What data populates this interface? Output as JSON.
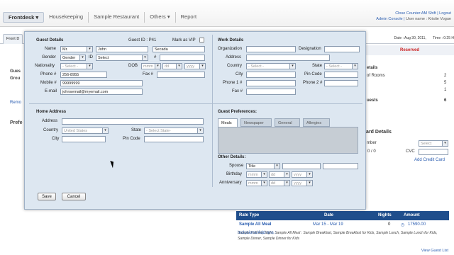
{
  "nav": {
    "items": [
      {
        "label": "Frontdesk ▾"
      },
      {
        "label": "Housekeeping"
      },
      {
        "label": "Sample Restaurant"
      },
      {
        "label": "Others ▾"
      },
      {
        "label": "Report"
      }
    ]
  },
  "header": {
    "close_counter": "Close Counter:AM Shift",
    "logout": "Logout",
    "admin_console": "Admin Console",
    "user_name": "User name : Kristie Vogue"
  },
  "background": {
    "front_tab": "Front D",
    "date": "Date : Aug 30, 2011,",
    "time": "Time : 0:25 H",
    "status": "Reserved",
    "guest_initial": "Gues",
    "group_initial": "Grou",
    "remove": "Remo",
    "prefs": "Prefe",
    "details": "etails",
    "rooms_label": "of Rooms",
    "rooms_val1": "2",
    "rooms_val2": "5",
    "rooms_val3": "1",
    "guests_label": "uests",
    "guests_val": "6",
    "card_details": "Card Details",
    "number_label": "mber",
    "number_val": "0  / 0",
    "cvc": "CVC",
    "select": "Select",
    "add_credit_card": "Add Credit Card",
    "view_guest_list": "View Guest List"
  },
  "rate_table": {
    "headers": {
      "rate_type": "Rate Type",
      "date": "Date",
      "nights": "Nights",
      "amount": "Amount"
    },
    "row": {
      "name": "Sample All Meal",
      "dates": "Mar 15 - Mar 19",
      "nights": "0",
      "amount": "17590.00"
    },
    "inclusions_label": "Inclusions/Add-ons :",
    "inclusions": "Sample Half day Sight, Sample All Meal : Sample Breakfast, Sample Breakfast for Kids, Sample Lunch, Sample Lunch for Kids, Sample Dinner, Sample Dinner for Kids"
  },
  "guest_details": {
    "title": "Guest Details",
    "guest_id": "Guest ID : P41",
    "mark_vip": "Mark as VIP",
    "name_label": "Name",
    "title_value": "Mr.",
    "first_name": "John",
    "last_name": "Secada",
    "gender_label": "Gender",
    "gender_value": "Gender",
    "id_label": "ID",
    "id_value": "Select",
    "hash_label": "#",
    "nationality_label": "Nationality",
    "nationality_value": "- Select -",
    "dob_label": "DOB",
    "dob_mm": "mmm",
    "dob_dd": "dd",
    "dob_yyyy": "yyyy",
    "phone_label": "Phone #",
    "phone_value": "256-8955",
    "fax_label": "Fax #",
    "mobile_label": "Mobile #",
    "mobile_value": "99999999",
    "email_label": "E-mail",
    "email_value": "johnsemail@myemail.com"
  },
  "work_details": {
    "title": "Work Details",
    "organization_label": "Organization",
    "designation_label": "Designation",
    "address_label": "Address",
    "country_label": "Country",
    "country_value": "- Select -",
    "state_label": "State",
    "state_value": "- Select -",
    "city_label": "City",
    "pincode_label": "Pin Code",
    "phone1_label": "Phone 1 #",
    "phone2_label": "Phone 2 #",
    "fax_label": "Fax #"
  },
  "home_address": {
    "title": "Home Address",
    "address_label": "Address",
    "country_label": "Country",
    "country_value": "United States",
    "state_label": "State",
    "state_value": "- Select State-",
    "city_label": "City",
    "pincode_label": "Pin Code"
  },
  "guest_preferences": {
    "title": "Guest Preferences:",
    "tabs": [
      {
        "label": "Meals"
      },
      {
        "label": "Newspaper"
      },
      {
        "label": "General"
      },
      {
        "label": "Allergies"
      }
    ]
  },
  "other_details": {
    "title": "Other Details:",
    "spouse_label": "Spouse",
    "spouse_title": "Title",
    "birthday_label": "Birthday",
    "anniversary_label": "Anniversary",
    "mm": "mmm",
    "dd": "dd",
    "yyyy": "yyyy"
  },
  "buttons": {
    "save": "Save",
    "cancel": "Cancel"
  }
}
